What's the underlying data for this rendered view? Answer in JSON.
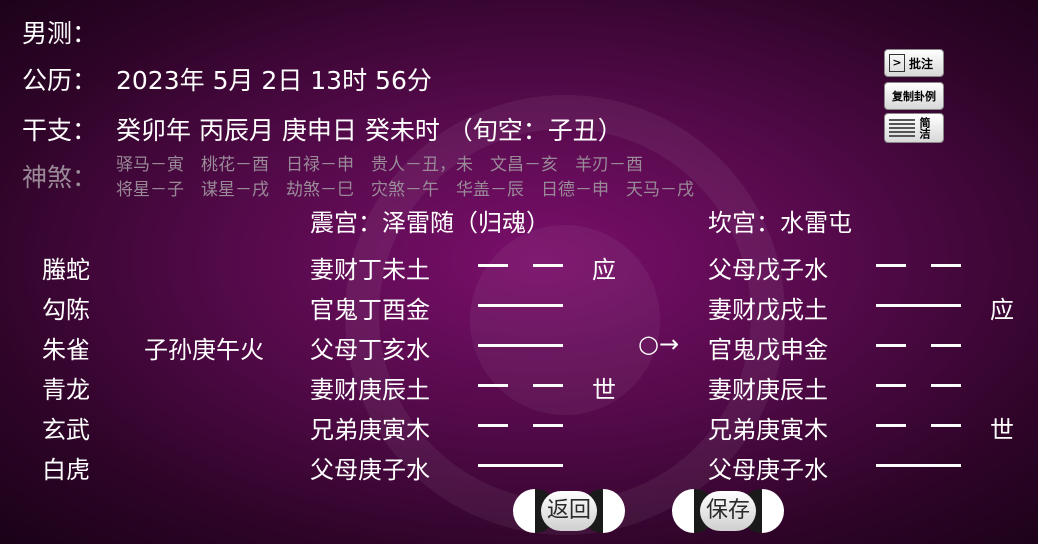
{
  "header": {
    "gender_label": "男测：",
    "calendar_label": "公历：",
    "calendar_value": "2023年 5月 2日 13时 56分",
    "ganzhi_label": "干支：",
    "ganzhi_value": "癸卯年 丙辰月 庚申日 癸未时 （旬空：子丑）",
    "shensha_label": "神煞：",
    "shensha_line1": "驿马－寅　桃花－酉　日禄－申　贵人－丑，未　文昌－亥　羊刃－酉",
    "shensha_line2": "将星－子　谋星－戌　劫煞－巳　灾煞－午　华盖－辰　日德－申　天马－戌"
  },
  "main_gua": {
    "title": "震宫：泽雷随（归魂）"
  },
  "changed_gua": {
    "title": "坎宫：水雷屯"
  },
  "liushen": [
    "螣蛇",
    "勾陈",
    "朱雀",
    "青龙",
    "玄武",
    "白虎"
  ],
  "fushen": [
    "",
    "",
    "子孙庚午火",
    "",
    "",
    ""
  ],
  "main_lines": [
    {
      "label": "妻财丁未土",
      "yin": true,
      "mark": "应"
    },
    {
      "label": "官鬼丁酉金",
      "yin": false,
      "mark": ""
    },
    {
      "label": "父母丁亥水",
      "yin": false,
      "mark": ""
    },
    {
      "label": "妻财庚辰土",
      "yin": true,
      "mark": "世"
    },
    {
      "label": "兄弟庚寅木",
      "yin": true,
      "mark": ""
    },
    {
      "label": "父母庚子水",
      "yin": false,
      "mark": ""
    }
  ],
  "moving_marks": [
    "",
    "",
    "○→",
    "",
    "",
    ""
  ],
  "changed_lines": [
    {
      "label": "父母戊子水",
      "yin": true,
      "mark": ""
    },
    {
      "label": "妻财戊戌土",
      "yin": false,
      "mark": "应"
    },
    {
      "label": "官鬼戊申金",
      "yin": true,
      "mark": ""
    },
    {
      "label": "妻财庚辰土",
      "yin": true,
      "mark": ""
    },
    {
      "label": "兄弟庚寅木",
      "yin": true,
      "mark": "世"
    },
    {
      "label": "父母庚子水",
      "yin": false,
      "mark": ""
    }
  ],
  "buttons": {
    "pizhu": "批注",
    "copy": "复制卦例",
    "jianjie": "简洁",
    "back": "返回",
    "save": "保存"
  }
}
